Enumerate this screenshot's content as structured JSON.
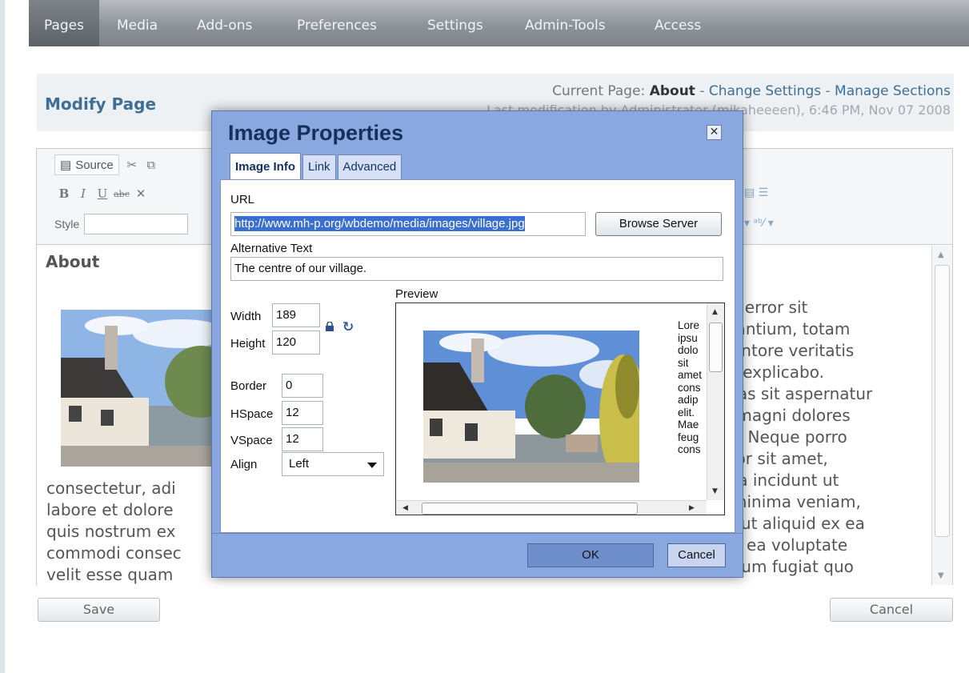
{
  "nav": {
    "items": [
      {
        "label": "Pages",
        "active": true
      },
      {
        "label": "Media"
      },
      {
        "label": "Add-ons"
      },
      {
        "label": "Preferences"
      },
      {
        "label": "Settings"
      },
      {
        "label": "Admin-Tools"
      },
      {
        "label": "Access"
      }
    ]
  },
  "header": {
    "title": "Modify Page",
    "current_prefix": "Current Page:",
    "current_page": "About",
    "sep": "-",
    "change_settings": "Change Settings",
    "manage_sections": "Manage Sections",
    "last_modification": "Last modification by Administrator (mikaheeeen), 6:46 PM, Nov 07 2008"
  },
  "editor": {
    "source_label": "Source",
    "style_label": "Style",
    "bold": "B",
    "italic": "I",
    "underline": "U",
    "strike": "abc",
    "heading": "About",
    "right_text": "s error sit\nlantium, totam\nentore veritatis\nt explicabo.\ntas sit aspernatur\n magni dolores\nt. Neque porro\nlor sit amet,\nra incidunt ut\nminima veniam,\ni ut aliquid ex ea\nn ea voluptate\neum fugiat quo",
    "left_text": "consectetur, adi\nlabore et dolore\nquis nostrum ex\ncommodi consec\nvelit esse quam"
  },
  "buttons": {
    "save": "Save",
    "cancel": "Cancel"
  },
  "dialog": {
    "title": "Image Properties",
    "close": "✕",
    "tabs": [
      "Image Info",
      "Link",
      "Advanced"
    ],
    "url_label": "URL",
    "url_value": "http://www.mh-p.org/wbdemo/media/images/village.jpg",
    "browse_label": "Browse Server",
    "alt_label": "Alternative Text",
    "alt_value": "The centre of our village.",
    "width_label": "Width",
    "width_value": "189",
    "height_label": "Height",
    "height_value": "120",
    "border_label": "Border",
    "border_value": "0",
    "hspace_label": "HSpace",
    "hspace_value": "12",
    "vspace_label": "VSpace",
    "vspace_value": "12",
    "align_label": "Align",
    "align_value": "Left",
    "preview_label": "Preview",
    "preview_text": "Lore\nipsu\ndolo\nsit\namet\ncons\nadip\nelit.\nMae\nfeug\ncons",
    "ok_label": "OK",
    "cancel_label": "Cancel"
  }
}
